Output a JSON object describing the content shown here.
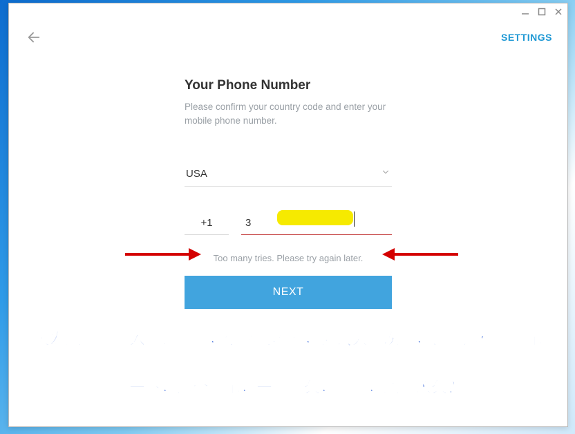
{
  "header": {
    "settings": "SETTINGS"
  },
  "form": {
    "title": "Your Phone Number",
    "subtitle": "Please confirm your country code and enter your mobile phone number.",
    "country": "USA",
    "code": "+1",
    "phone": "3",
    "error": "Too many tries. Please try again later.",
    "next": "NEXT"
  },
  "annotation": {
    "line1": "昨天发送过多登入验证短信，依然没收到，尝试太多次了，已经这样的提示了",
    "line2": "问一下，这个提示，一般多久，解封，还是永久？"
  }
}
